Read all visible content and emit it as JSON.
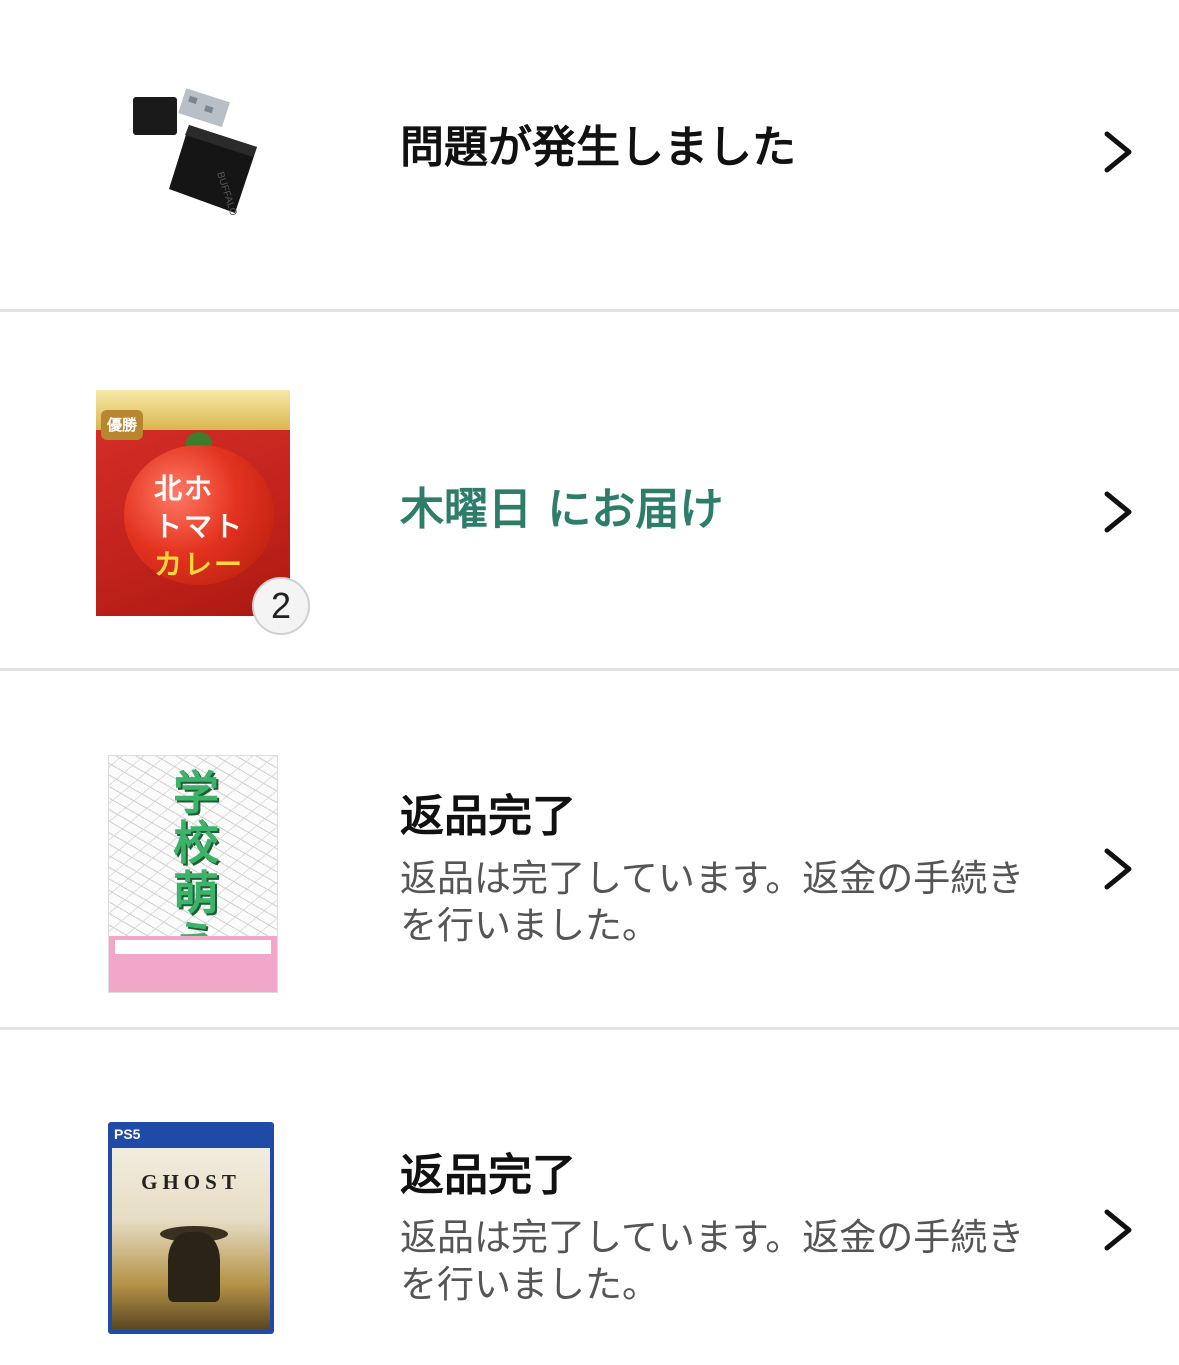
{
  "orders": [
    {
      "thumb_icon": "usb-flash-drive-image",
      "title": "問題が発生しました",
      "title_color": "#111111",
      "subtitle": "",
      "quantity": ""
    },
    {
      "thumb_icon": "tomato-curry-box-image",
      "title": "木曜日 にお届け",
      "title_color": "#2e7d6b",
      "subtitle": "",
      "quantity": "2"
    },
    {
      "thumb_icon": "school-art-book-image",
      "title": "返品完了",
      "title_color": "#111111",
      "subtitle": "返品は完了しています。返金の手続きを行いました。",
      "quantity": ""
    },
    {
      "thumb_icon": "ps5-game-case-image",
      "title": "返品完了",
      "title_color": "#111111",
      "subtitle": "返品は完了しています。返金の手続きを行いました。",
      "quantity": ""
    }
  ],
  "product_art": {
    "curry_line1": "北ホ",
    "curry_line2": "トマト",
    "curry_line3": "カレー",
    "curry_badge": "優勝",
    "book_title": "学校萌え",
    "ps5_logo": "PS5",
    "ps5_title": "GHOST"
  },
  "colors": {
    "divider": "#e3e3e3",
    "accent_green": "#2e7d6b",
    "subtitle_gray": "#555555"
  }
}
